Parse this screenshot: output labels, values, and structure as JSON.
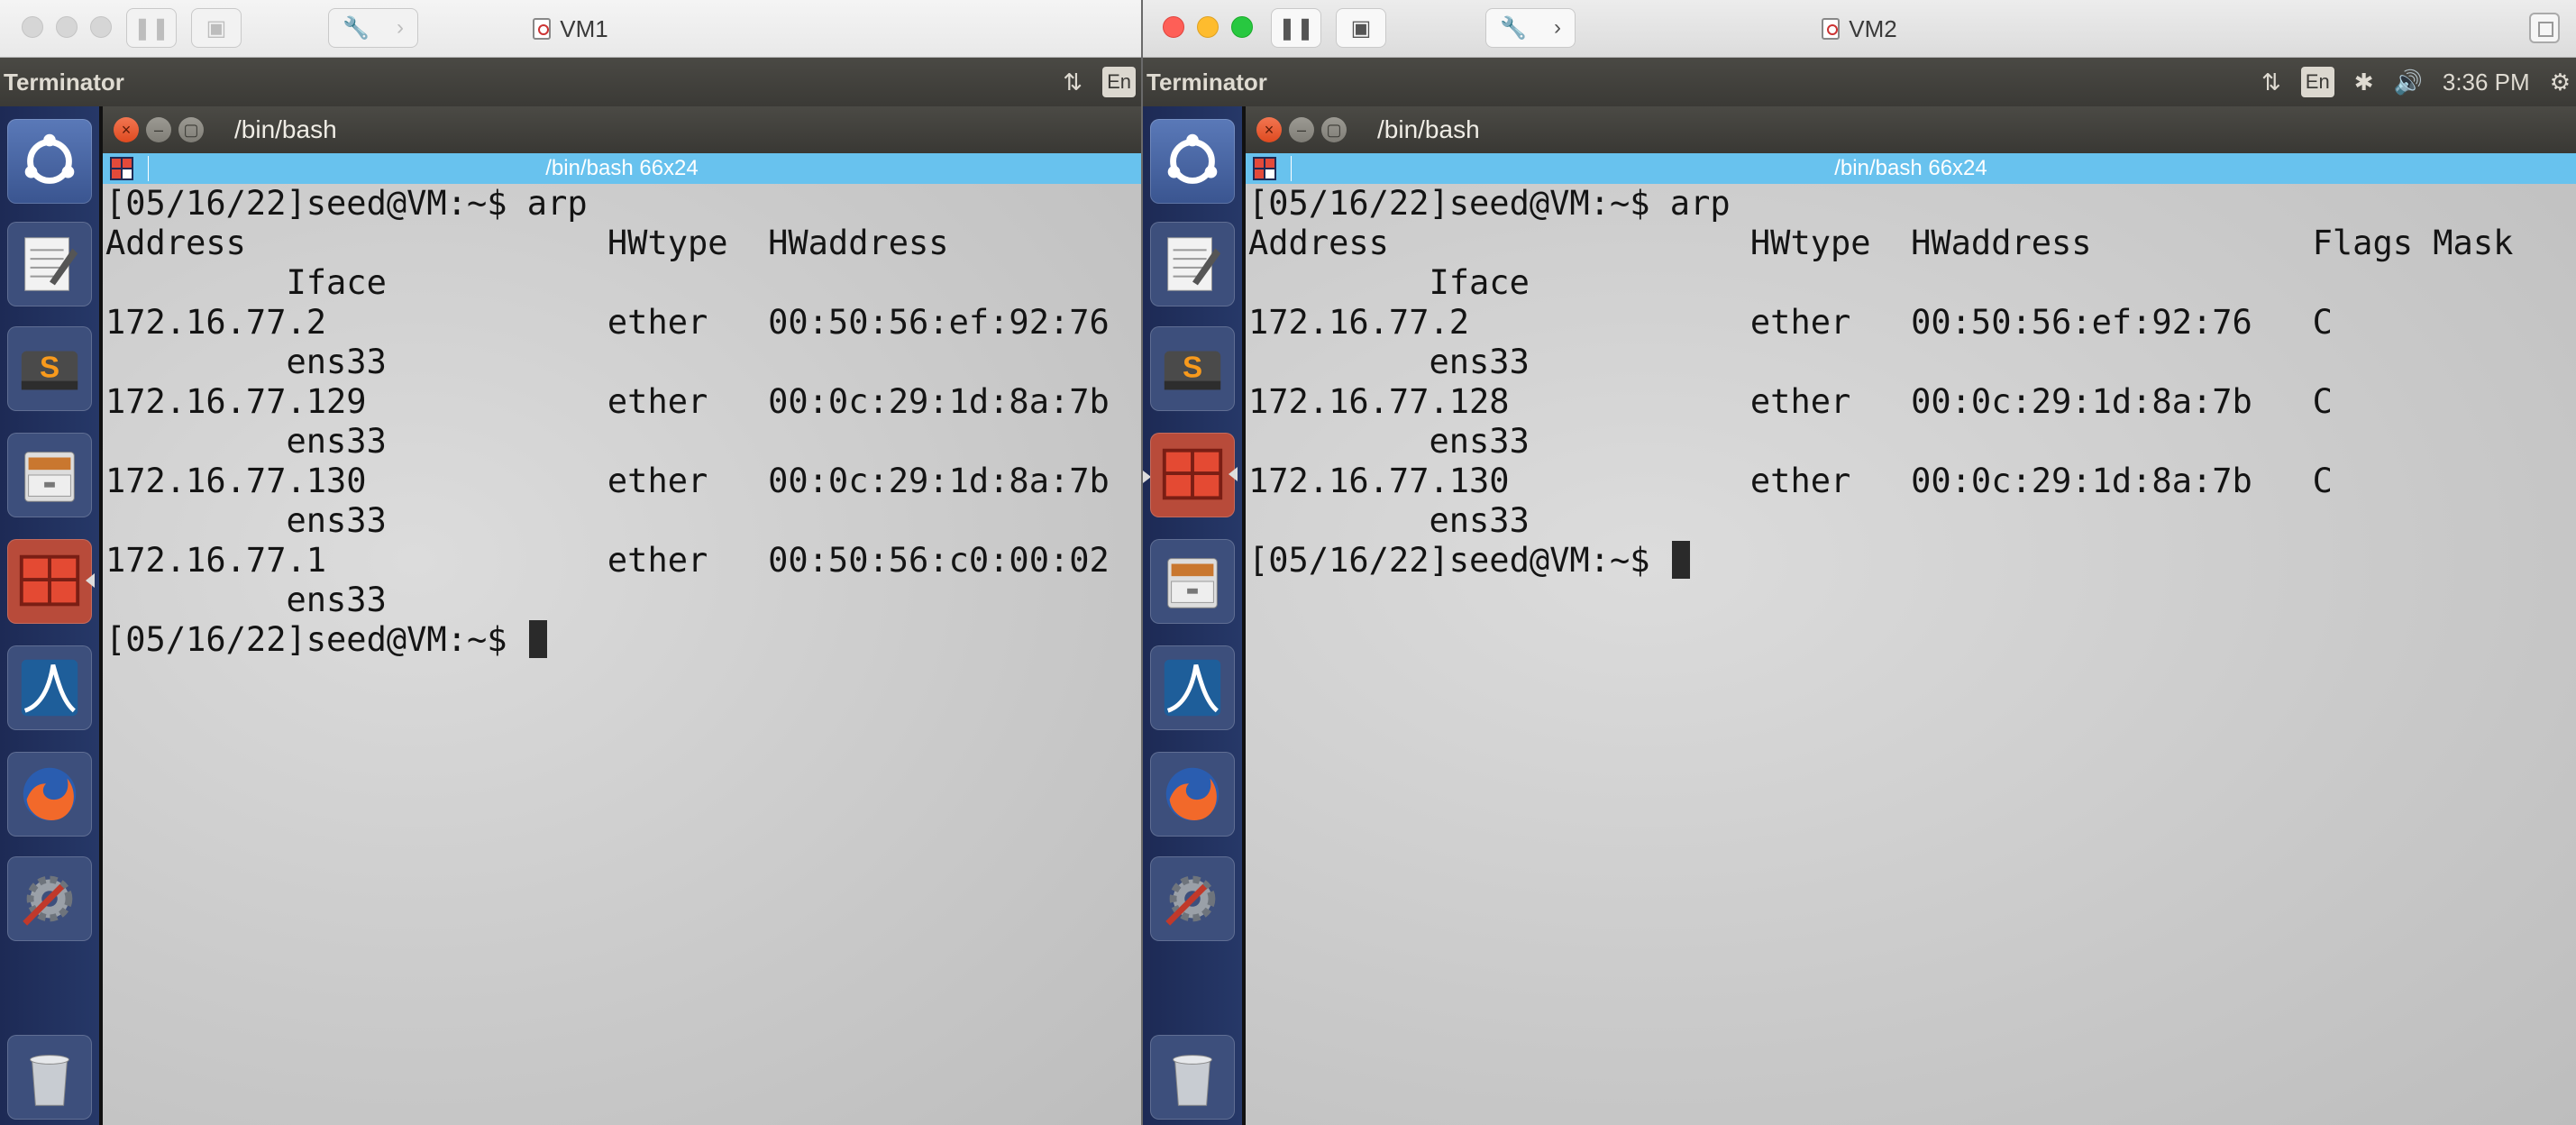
{
  "vm1": {
    "window_title": "VM1",
    "topbar": {
      "app_name": "Terminator",
      "lang": "En"
    },
    "terminal": {
      "title": "/bin/bash",
      "tab_label": "/bin/bash 66x24",
      "lines": [
        "[05/16/22]seed@VM:~$ arp",
        "Address                  HWtype  HWaddress         ",
        "         Iface",
        "172.16.77.2              ether   00:50:56:ef:92:76 ",
        "         ens33",
        "172.16.77.129            ether   00:0c:29:1d:8a:7b ",
        "         ens33",
        "172.16.77.130            ether   00:0c:29:1d:8a:7b ",
        "         ens33",
        "172.16.77.1              ether   00:50:56:c0:00:02 ",
        "         ens33"
      ],
      "prompt": "[05/16/22]seed@VM:~$ "
    }
  },
  "vm2": {
    "window_title": "VM2",
    "topbar": {
      "app_name": "Terminator",
      "lang": "En",
      "time": "3:36 PM"
    },
    "terminal": {
      "title": "/bin/bash",
      "tab_label": "/bin/bash 66x24",
      "lines": [
        "[05/16/22]seed@VM:~$ arp",
        "Address                  HWtype  HWaddress           Flags Mask",
        "         Iface",
        "172.16.77.2              ether   00:50:56:ef:92:76   C",
        "         ens33",
        "172.16.77.128            ether   00:0c:29:1d:8a:7b   C",
        "         ens33",
        "172.16.77.130            ether   00:0c:29:1d:8a:7b   C",
        "         ens33"
      ],
      "prompt": "[05/16/22]seed@VM:~$ "
    }
  },
  "launcher_icons": [
    "ubuntu-dash-icon",
    "text-editor-icon",
    "sublime-text-icon",
    "files-icon",
    "terminator-icon",
    "wireshark-icon",
    "firefox-icon",
    "system-settings-icon",
    "trash-icon"
  ],
  "colors": {
    "launcher": "#1d2a55",
    "tab_bar": "#68c2ee",
    "title_bar": "#3b3a36",
    "terminal_bg": "#cfcfcf"
  }
}
